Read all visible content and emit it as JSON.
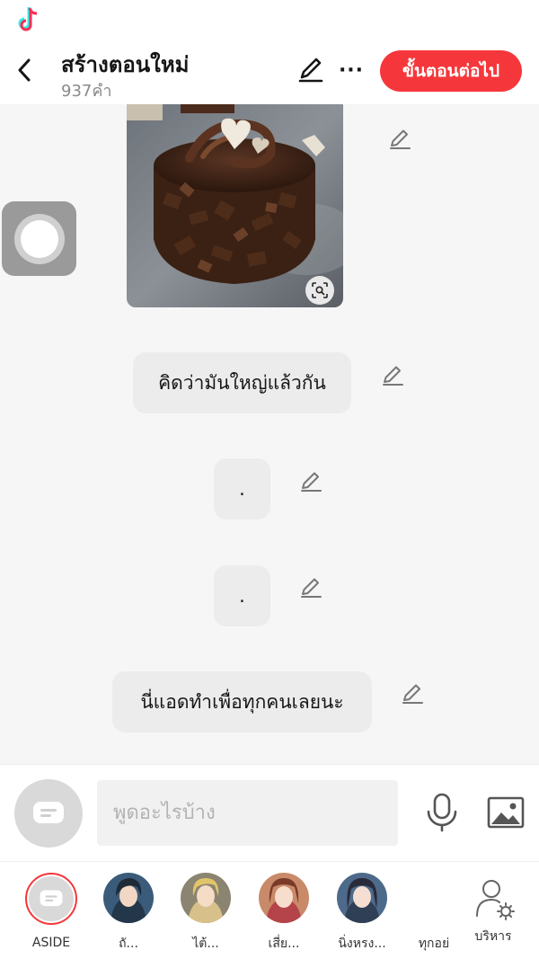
{
  "header": {
    "title": "สร้างตอนใหม่",
    "word_count": "937คำ",
    "next_label": "ขั้นตอนต่อไป",
    "more_label": "···"
  },
  "messages": [
    {
      "type": "image",
      "icon": "chocolate-cake-photo"
    },
    {
      "type": "text",
      "text": "คิดว่ามันใหญ่แล้วกัน"
    },
    {
      "type": "text",
      "text": "."
    },
    {
      "type": "text",
      "text": "."
    },
    {
      "type": "text",
      "text": "นี่แอดทำเพื่อทุกคนเลยนะ"
    }
  ],
  "input": {
    "placeholder": "พูดอะไรบ้าง"
  },
  "characters": [
    {
      "name": "ASIDE",
      "icon": "chat-bubble-icon"
    },
    {
      "name": "ถั..."
    },
    {
      "name": "ไต้..."
    },
    {
      "name": "เสี่ย..."
    },
    {
      "name": "นิ่งหรง..."
    },
    {
      "name": "ทุกอย่"
    },
    {
      "name": "บริหาร",
      "icon": "user-settings-icon"
    }
  ],
  "colors": {
    "accent": "#f5373b",
    "bubble": "#ececec",
    "background": "#f6f6f6"
  }
}
